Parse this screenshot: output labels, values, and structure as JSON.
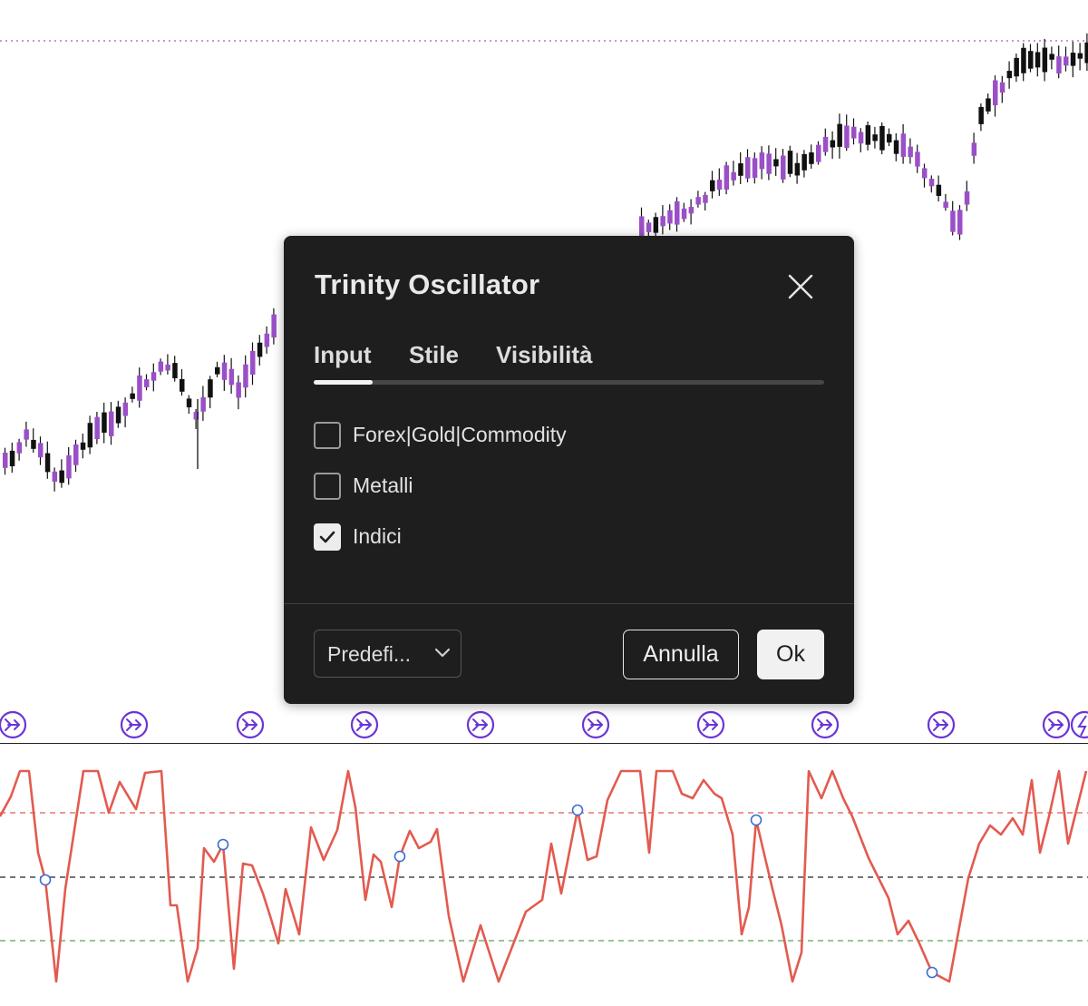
{
  "colors": {
    "bull_candle": "#9b4fc7",
    "bear_candle": "#111111",
    "oscillator_line": "#e35a4f",
    "upper_level": "#e35a4f",
    "middle_level": "#222222",
    "lower_level": "#5aa651",
    "marker": "#6a35d6",
    "dialog_bg": "#1e1e1e"
  },
  "dialog": {
    "title": "Trinity Oscillator",
    "close_icon": "close-icon",
    "tabs": [
      {
        "label": "Input",
        "active": true
      },
      {
        "label": "Stile",
        "active": false
      },
      {
        "label": "Visibilità",
        "active": false
      }
    ],
    "options": [
      {
        "label": "Forex|Gold|Commodity",
        "checked": false
      },
      {
        "label": "Metalli",
        "checked": false
      },
      {
        "label": "Indici",
        "checked": true
      }
    ],
    "preset": {
      "label": "Predefi...",
      "icon": "chevron-down-icon"
    },
    "cancel_label": "Annulla",
    "ok_label": "Ok"
  },
  "marker_icon": "arrow-right-circle-icon"
}
